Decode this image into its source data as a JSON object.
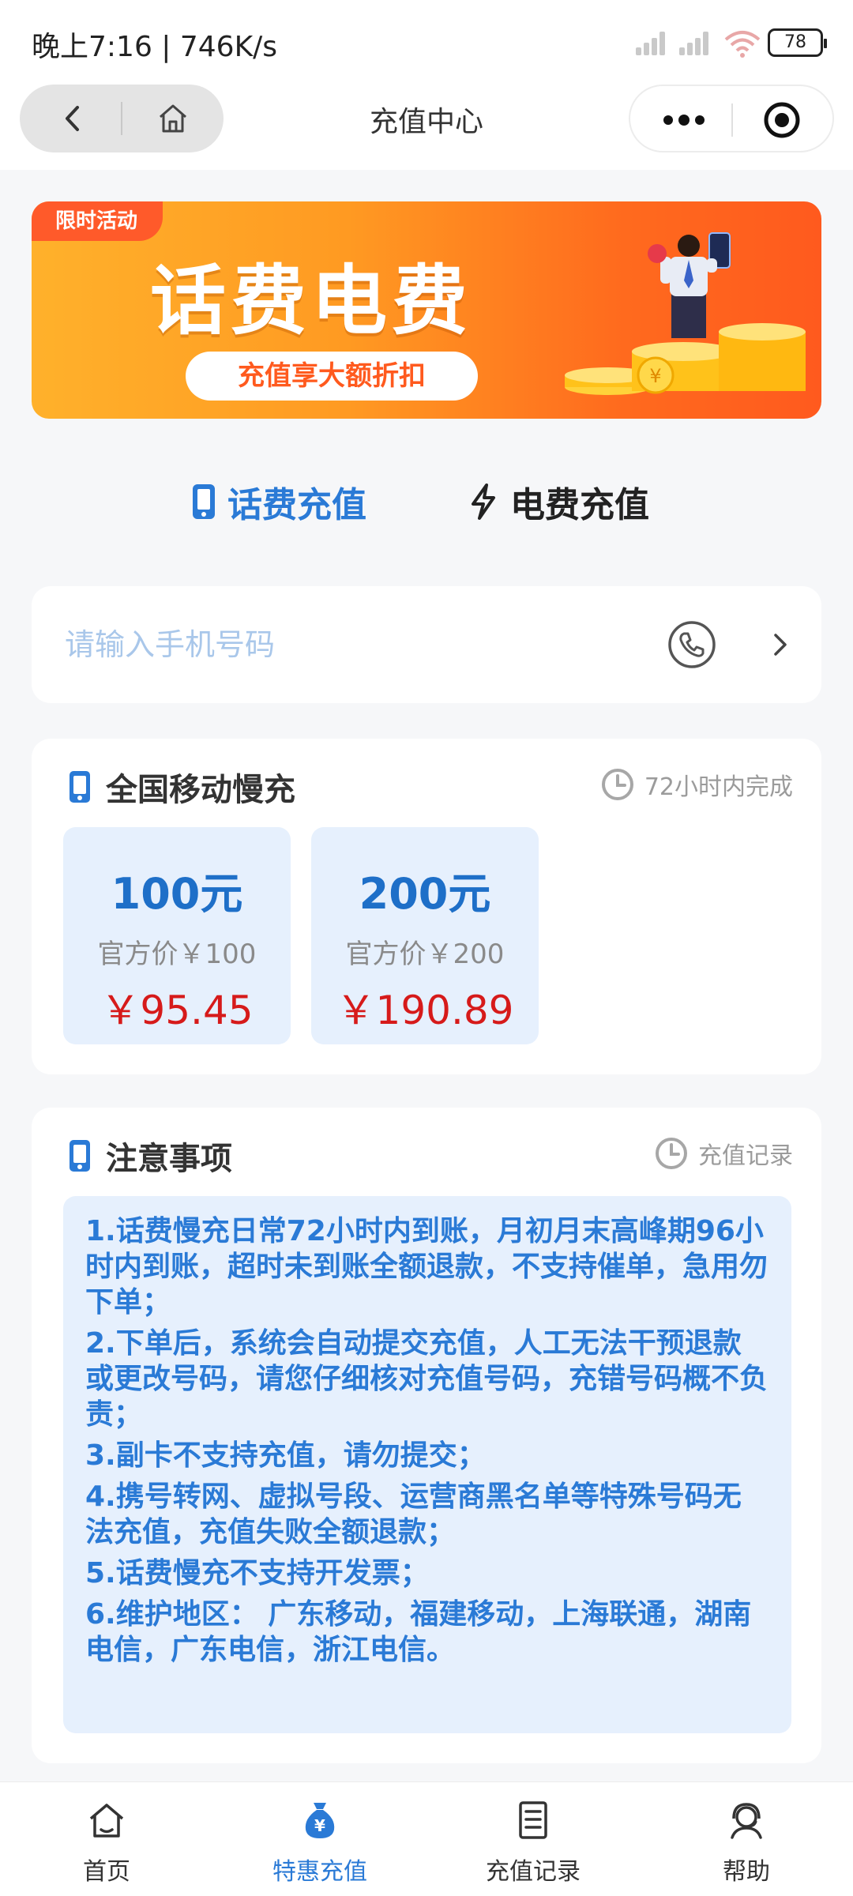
{
  "status_bar": {
    "time": "晚上7:16 | 746K/s",
    "battery": "78"
  },
  "nav": {
    "title": "充值中心"
  },
  "banner": {
    "badge": "限时活动",
    "headline": "话费电费",
    "subtitle": "充值享大额折扣"
  },
  "tabs": [
    {
      "label": "话费充值",
      "active": true
    },
    {
      "label": "电费充值",
      "active": false
    }
  ],
  "phone_input": {
    "placeholder": "请输入手机号码",
    "value": ""
  },
  "product_section": {
    "title": "全国移动慢充",
    "eta": "72小时内完成",
    "options": [
      {
        "amount": "100元",
        "official": "官方价￥100",
        "price": "￥95.45"
      },
      {
        "amount": "200元",
        "official": "官方价￥200",
        "price": "￥190.89"
      }
    ]
  },
  "notes_section": {
    "title": "注意事项",
    "records_link": "充值记录",
    "items": [
      "1.话费慢充日常72小时内到账，月初月末高峰期96小时内到账，超时未到账全额退款，不支持催单，急用勿下单；",
      "2.下单后，系统会自动提交充值，人工无法干预退款或更改号码，请您仔细核对充值号码，充错号码概不负责；",
      "3.副卡不支持充值，请勿提交；",
      "4.携号转网、虚拟号段、运营商黑名单等特殊号码无法充值，充值失败全额退款；",
      "5.话费慢充不支持开发票；",
      "6.维护地区： 广东移动，福建移动，上海联通，湖南电信，广东电信，浙江电信。"
    ]
  },
  "tabbar": [
    {
      "label": "首页",
      "icon": "home-icon",
      "active": false
    },
    {
      "label": "特惠充值",
      "icon": "money-bag-icon",
      "active": true
    },
    {
      "label": "充值记录",
      "icon": "document-icon",
      "active": false
    },
    {
      "label": "帮助",
      "icon": "support-agent-icon",
      "active": false
    }
  ],
  "colors": {
    "accent": "#2a7ad6",
    "price": "#d61a1a",
    "banner_start": "#ffb12b",
    "banner_end": "#ff5a1e"
  }
}
